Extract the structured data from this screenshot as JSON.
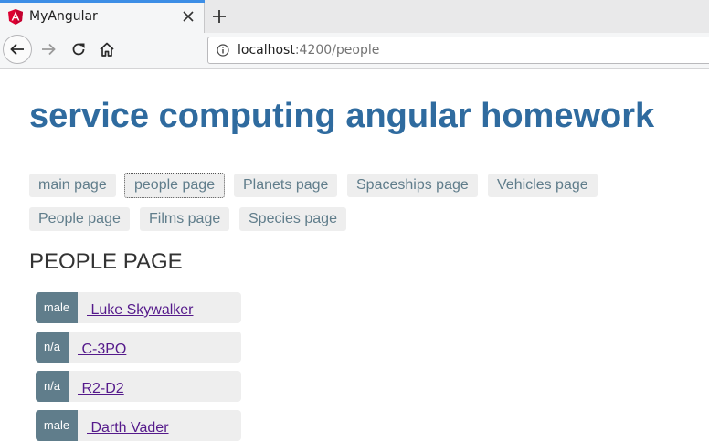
{
  "browser": {
    "tab_title": "MyAngular",
    "url_host": "localhost",
    "url_rest": ":4200/people"
  },
  "page": {
    "title": "service computing angular homework",
    "nav_links": [
      "main page",
      "people page",
      "Planets page",
      "Spaceships page",
      "Vehicles page",
      "People page",
      "Films page",
      "Species page"
    ],
    "active_nav": "people page",
    "section_heading": "PEOPLE PAGE",
    "people": [
      {
        "gender": "male",
        "name": " Luke Skywalker"
      },
      {
        "gender": "n/a",
        "name": " C-3PO"
      },
      {
        "gender": "n/a",
        "name": " R2-D2"
      },
      {
        "gender": "male",
        "name": " Darth Vader"
      }
    ]
  },
  "colors": {
    "title": "#2f6b9f",
    "badge": "#607d8b",
    "link_visited": "#551a8b",
    "tab_accent": "#3d8ee6"
  }
}
